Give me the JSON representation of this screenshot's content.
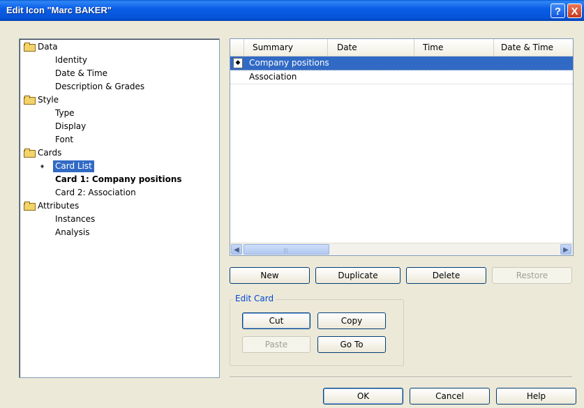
{
  "window": {
    "title": "Edit Icon \"Marc BAKER\"",
    "help_glyph": "?",
    "close_glyph": "X"
  },
  "tree": {
    "data": "Data",
    "identity": "Identity",
    "date_time": "Date & Time",
    "description": "Description & Grades",
    "style": "Style",
    "type": "Type",
    "display": "Display",
    "font": "Font",
    "cards": "Cards",
    "card_list": "Card List",
    "card1": "Card 1: Company positions",
    "card2": "Card 2: Association",
    "attributes": "Attributes",
    "instances": "Instances",
    "analysis": "Analysis"
  },
  "list": {
    "columns": [
      "Summary",
      "Date",
      "Time",
      "Date & Time"
    ],
    "rows": [
      "Company positions",
      "Association"
    ],
    "selected_row": 0
  },
  "buttons": {
    "new": "New",
    "duplicate": "Duplicate",
    "delete": "Delete",
    "restore": "Restore"
  },
  "edit_card": {
    "label": "Edit Card",
    "cut": "Cut",
    "copy": "Copy",
    "paste": "Paste",
    "goto": "Go To"
  },
  "footer": {
    "ok": "OK",
    "cancel": "Cancel",
    "help": "Help"
  },
  "colors": {
    "selection": "#316ac5",
    "titlebar": "#0a5ed8",
    "dialog_bg": "#ece9d8"
  }
}
